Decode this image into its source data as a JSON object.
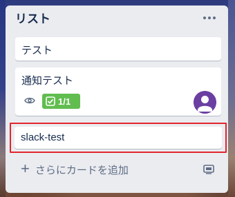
{
  "list": {
    "title": "リスト",
    "menu_icon": "ellipsis-icon"
  },
  "cards": [
    {
      "title": "テスト"
    },
    {
      "title": "通知テスト",
      "watch_icon": "eye-icon",
      "checklist": {
        "icon": "checkbox-icon",
        "count": "1/1",
        "color": "#61bd4f"
      },
      "member_avatar": "avatar-icon"
    }
  ],
  "editing_card": {
    "title": "slack-test",
    "highlight_color": "#e0252b"
  },
  "footer": {
    "add_card_label": "さらにカードを追加",
    "add_icon": "plus-icon",
    "template_icon": "card-template-icon"
  }
}
